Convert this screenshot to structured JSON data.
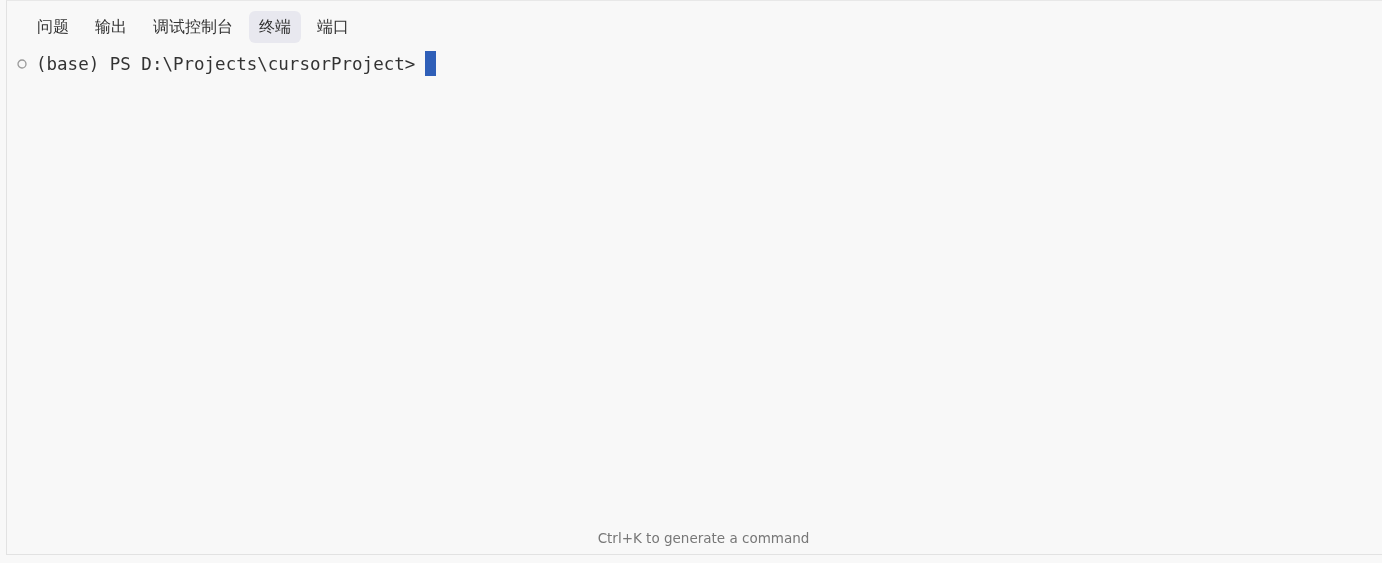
{
  "tabs": [
    {
      "label": "问题",
      "selected": false
    },
    {
      "label": "输出",
      "selected": false
    },
    {
      "label": "调试控制台",
      "selected": false
    },
    {
      "label": "终端",
      "selected": true
    },
    {
      "label": "端口",
      "selected": false
    }
  ],
  "terminal": {
    "prompt": "(base) PS D:\\Projects\\cursorProject>",
    "cursor_visible": true
  },
  "hint": "Ctrl+K to generate a command"
}
